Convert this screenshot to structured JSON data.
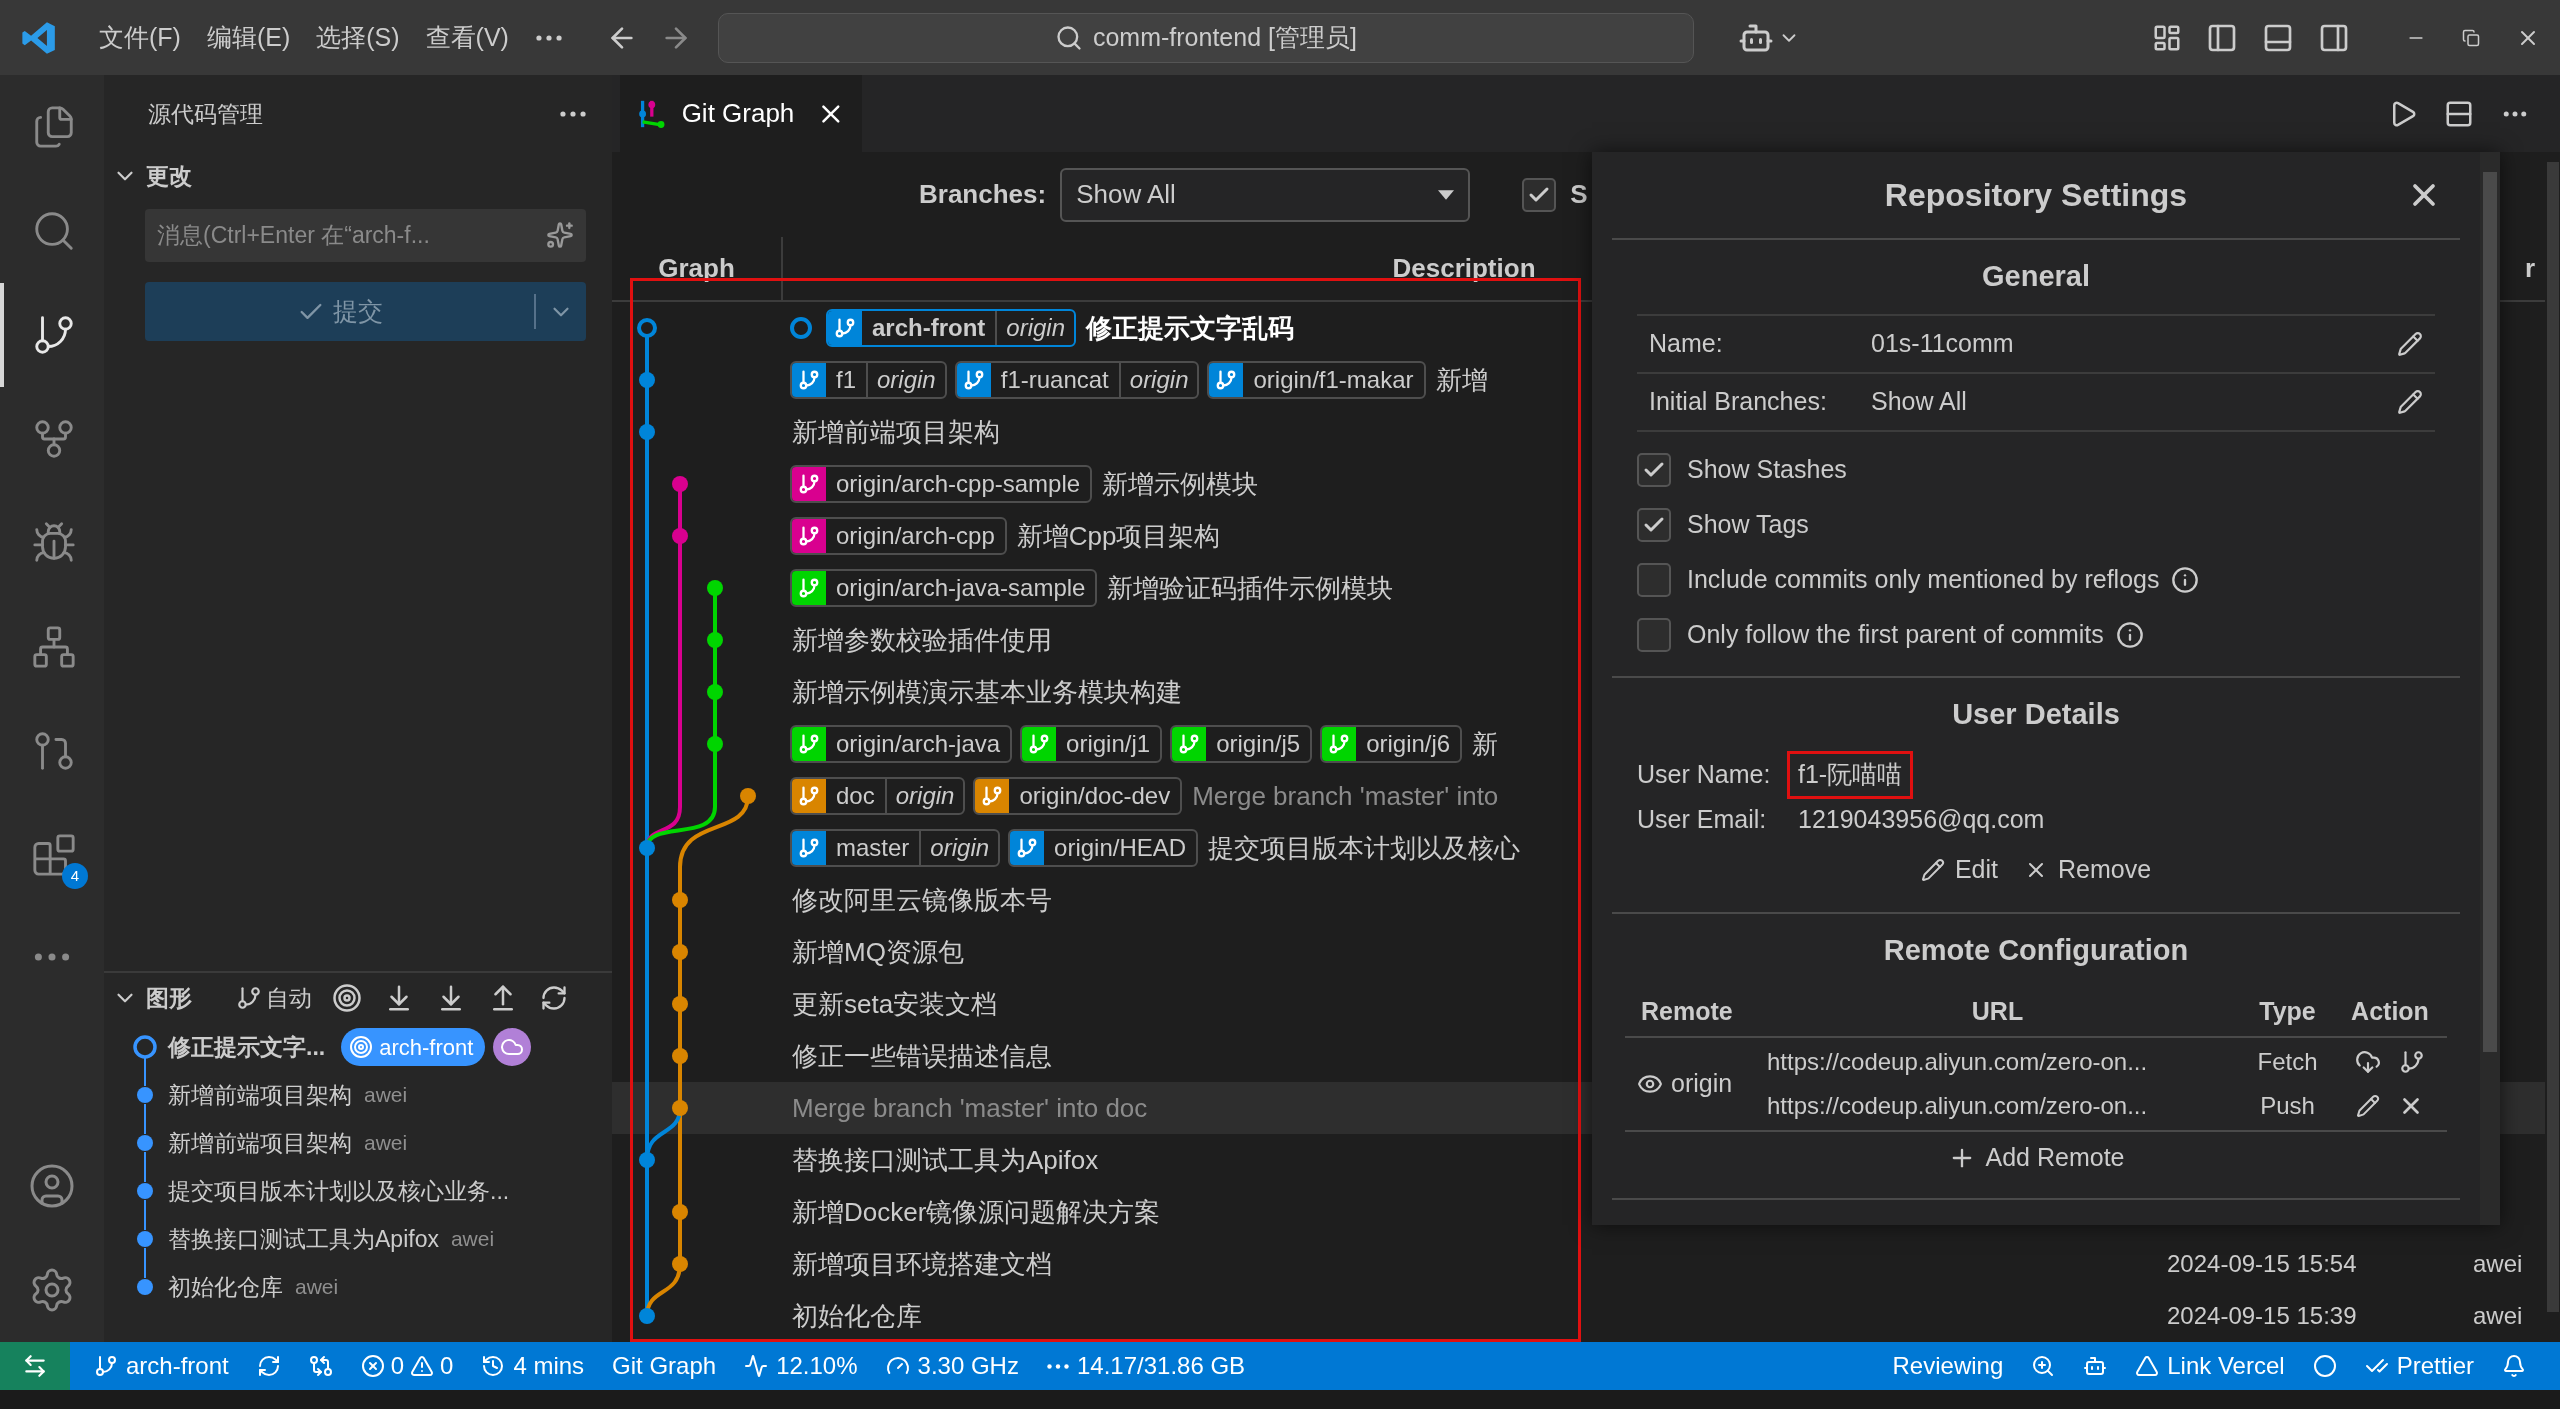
{
  "title_bar": {
    "menus": [
      "文件(F)",
      "编辑(E)",
      "选择(S)",
      "查看(V)"
    ],
    "command_center": "comm-frontend [管理员]"
  },
  "activity_bar": {
    "items": [
      {
        "kind": "explorer",
        "selected": false
      },
      {
        "kind": "search",
        "selected": false
      },
      {
        "kind": "scm",
        "selected": true
      },
      {
        "kind": "fork",
        "selected": false
      },
      {
        "kind": "debug",
        "selected": false
      },
      {
        "kind": "tree",
        "selected": false
      },
      {
        "kind": "pull",
        "selected": false
      },
      {
        "kind": "extensions",
        "selected": false,
        "badge": "4"
      }
    ]
  },
  "sidebar": {
    "title": "源代码管理",
    "changes": {
      "title": "更改",
      "expanded": true,
      "message_placeholder": "消息(Ctrl+Enter 在“arch-f...",
      "commit_label": "提交",
      "disabled": true
    },
    "graph": {
      "title": "图形",
      "expanded": true,
      "auto_label": "自动",
      "commits": [
        {
          "message": "修正提示文字...",
          "current": true,
          "branch": "arch-front"
        },
        {
          "message": "新增前端项目架构",
          "current": false,
          "author": "awei"
        },
        {
          "message": "新增前端项目架构",
          "current": false,
          "author": "awei"
        },
        {
          "message": "提交项目版本计划以及核心业务...",
          "current": false
        },
        {
          "message": "替换接口测试工具为Apifox",
          "current": false,
          "author": "awei"
        },
        {
          "message": "初始化仓库",
          "current": false,
          "author": "awei"
        }
      ]
    }
  },
  "editor": {
    "tabs": [
      {
        "label": "Git Graph",
        "selected": true
      }
    ],
    "git_graph": {
      "branches_label": "Branches:",
      "branches_value": "Show All",
      "show_option": {
        "label": "S",
        "checked": true
      },
      "columns": [
        "Graph",
        "Description",
        "r"
      ],
      "highlighted": true,
      "rows": [
        {
          "refs": [
            {
              "name": "arch-front",
              "remote": "origin",
              "color": "#0085d9"
            }
          ],
          "message": "修正提示文字乱码",
          "current": true,
          "muted": false,
          "selected": false
        },
        {
          "refs": [
            {
              "name": "f1",
              "remote": "origin",
              "color": "#0085d9"
            },
            {
              "name": "f1-ruancat",
              "remote": "origin",
              "color": "#0085d9"
            },
            {
              "name": "origin/f1-makar",
              "color": "#0085d9"
            }
          ],
          "message": "新增",
          "current": false,
          "muted": false,
          "selected": false
        },
        {
          "refs": [],
          "message": "新增前端项目架构",
          "current": false,
          "muted": false,
          "selected": false
        },
        {
          "refs": [
            {
              "name": "origin/arch-cpp-sample",
              "color": "#d9008f"
            }
          ],
          "message": "新增示例模块",
          "current": false,
          "muted": false,
          "selected": false
        },
        {
          "refs": [
            {
              "name": "origin/arch-cpp",
              "color": "#d9008f"
            }
          ],
          "message": "新增Cpp项目架构",
          "current": false,
          "muted": false,
          "selected": false
        },
        {
          "refs": [
            {
              "name": "origin/arch-java-sample",
              "color": "#00d500"
            }
          ],
          "message": "新增验证码插件示例模块",
          "current": false,
          "muted": false,
          "selected": false
        },
        {
          "refs": [],
          "message": "新增参数校验插件使用",
          "current": false,
          "muted": false,
          "selected": false
        },
        {
          "refs": [],
          "message": "新增示例模演示基本业务模块构建",
          "current": false,
          "muted": false,
          "selected": false
        },
        {
          "refs": [
            {
              "name": "origin/arch-java",
              "color": "#00d500"
            },
            {
              "name": "origin/j1",
              "color": "#00d500"
            },
            {
              "name": "origin/j5",
              "color": "#00d500"
            },
            {
              "name": "origin/j6",
              "color": "#00d500"
            }
          ],
          "message": "新",
          "current": false,
          "muted": false,
          "selected": false
        },
        {
          "refs": [
            {
              "name": "doc",
              "remote": "origin",
              "color": "#d98500"
            },
            {
              "name": "origin/doc-dev",
              "color": "#d98500"
            }
          ],
          "message": "Merge branch 'master' into",
          "current": false,
          "muted": true,
          "selected": false
        },
        {
          "refs": [
            {
              "name": "master",
              "remote": "origin",
              "color": "#0085d9"
            },
            {
              "name": "origin/HEAD",
              "color": "#0085d9"
            }
          ],
          "message": "提交项目版本计划以及核心",
          "current": false,
          "muted": false,
          "selected": false
        },
        {
          "refs": [],
          "message": "修改阿里云镜像版本号",
          "current": false,
          "muted": false,
          "selected": false
        },
        {
          "refs": [],
          "message": "新增MQ资源包",
          "current": false,
          "muted": false,
          "selected": false
        },
        {
          "refs": [],
          "message": "更新seta安装文档",
          "current": false,
          "muted": false,
          "selected": false
        },
        {
          "refs": [],
          "message": "修正一些错误描述信息",
          "current": false,
          "muted": false,
          "selected": false
        },
        {
          "refs": [],
          "message": "Merge branch 'master' into doc",
          "current": false,
          "muted": true,
          "selected": true
        },
        {
          "refs": [],
          "message": "替换接口测试工具为Apifox",
          "current": false,
          "muted": false,
          "selected": false
        },
        {
          "refs": [],
          "message": "新增Docker镜像源问题解决方案",
          "current": false,
          "muted": false,
          "selected": false
        },
        {
          "refs": [],
          "message": "新增项目环境搭建文档",
          "current": false,
          "muted": false,
          "selected": false,
          "date": "2024-09-15 15:54",
          "author": "awei"
        },
        {
          "refs": [],
          "message": "初始化仓库",
          "current": false,
          "muted": false,
          "selected": false,
          "date": "2024-09-15 15:39",
          "author": "awei"
        }
      ]
    },
    "settings": {
      "title": "Repository Settings",
      "general": {
        "title": "General",
        "fields": [
          {
            "label": "Name:",
            "value": "01s-11comm"
          },
          {
            "label": "Initial Branches:",
            "value": "Show All"
          }
        ],
        "options": [
          {
            "label": "Show Stashes",
            "checked": true,
            "info": false
          },
          {
            "label": "Show Tags",
            "checked": true,
            "info": false
          },
          {
            "label": "Include commits only mentioned by reflogs",
            "checked": false,
            "info": true
          },
          {
            "label": "Only follow the first parent of commits",
            "checked": false,
            "info": true
          }
        ]
      },
      "user": {
        "title": "User Details",
        "name_label": "User Name:",
        "name": "f1-阮喵喵",
        "name_highlighted": true,
        "email_label": "User Email:",
        "email": "1219043956@qq.com",
        "actions": [
          {
            "kind": "edit",
            "label": "Edit"
          },
          {
            "kind": "remove",
            "label": "Remove"
          }
        ]
      },
      "remotes": {
        "title": "Remote Configuration",
        "columns": [
          "Remote",
          "URL",
          "Type",
          "Action"
        ],
        "items": [
          {
            "name": "origin",
            "urls": [
              {
                "kind": "fetch",
                "url": "https://codeup.aliyun.com/zero-on...",
                "type": "Fetch"
              },
              {
                "kind": "push",
                "url": "https://codeup.aliyun.com/zero-on...",
                "type": "Push"
              }
            ]
          }
        ],
        "add_label": "Add Remote"
      }
    }
  },
  "status_bar": {
    "left": [
      {
        "kind": "branch",
        "text": "arch-front"
      },
      {
        "kind": "sync"
      },
      {
        "kind": "graph"
      },
      {
        "kind": "problems",
        "errors": "0",
        "warnings": "0"
      },
      {
        "kind": "history",
        "text": "4 mins"
      },
      {
        "kind": "plain",
        "text": "Git Graph"
      },
      {
        "kind": "cpu",
        "text": "12.10%"
      },
      {
        "kind": "gauge",
        "text": "3.30 GHz"
      },
      {
        "kind": "memory",
        "text": "14.17/31.86 GB"
      }
    ],
    "right": [
      {
        "kind": "plain",
        "text": "Reviewing"
      },
      {
        "kind": "zoom"
      },
      {
        "kind": "copilot"
      },
      {
        "kind": "vercel",
        "text": "Link Vercel"
      },
      {
        "kind": "circle"
      },
      {
        "kind": "prettier",
        "text": "Prettier"
      },
      {
        "kind": "bell"
      }
    ]
  }
}
